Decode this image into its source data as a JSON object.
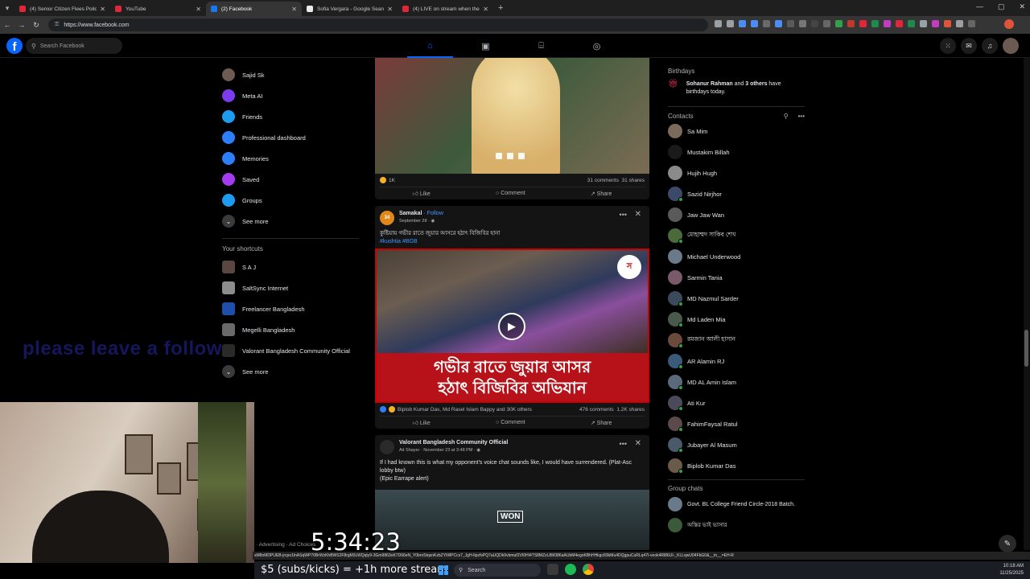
{
  "browser": {
    "tabs": [
      {
        "title": "(4) Senior Citizen Flees Police o",
        "color": "#e0263a"
      },
      {
        "title": "YouTube",
        "color": "#e0263a"
      },
      {
        "title": "(2) Facebook",
        "color": "#1877f2"
      },
      {
        "title": "Sofia Vergara - Google Search",
        "color": "#e8eaed"
      },
      {
        "title": "(4) LIVE on stream when the Ki",
        "color": "#e0263a"
      }
    ],
    "active_tab": 2,
    "url": "https://www.facebook.com"
  },
  "fb": {
    "search_placeholder": "Search Facebook",
    "nav_icons": [
      "home-icon",
      "video-icon",
      "marketplace-icon",
      "groups-icon"
    ],
    "left_nav": [
      {
        "label": "Sajid Sk",
        "icon": "profile-avatar",
        "color": "#6d5a52"
      },
      {
        "label": "Meta AI",
        "icon": "meta-ai-icon",
        "color": "#7b3cf0"
      },
      {
        "label": "Friends",
        "icon": "friends-icon",
        "color": "#1d9bf0"
      },
      {
        "label": "Professional dashboard",
        "icon": "dashboard-icon",
        "color": "#2d7ff9"
      },
      {
        "label": "Memories",
        "icon": "memories-icon",
        "color": "#2d7ff9"
      },
      {
        "label": "Saved",
        "icon": "saved-icon",
        "color": "#a33cf0"
      },
      {
        "label": "Groups",
        "icon": "groups-icon",
        "color": "#1d9bf0"
      },
      {
        "label": "See more",
        "icon": "chevron-down-icon",
        "color": "#3a3b3c"
      }
    ],
    "shortcuts_title": "Your shortcuts",
    "shortcuts": [
      {
        "label": "S A J",
        "color": "#5a4840"
      },
      {
        "label": "SaltSync Internet",
        "color": "#8c8c8c"
      },
      {
        "label": "Freelancer Bangladesh",
        "color": "#1f4fa8"
      },
      {
        "label": "Megelli Bangladesh",
        "color": "#6a6a6a"
      },
      {
        "label": "Valorant Bangladesh Community Official",
        "color": "#2a2a2a"
      },
      {
        "label": "See more",
        "color": "#3a3b3c"
      }
    ],
    "posts": {
      "p1": {
        "reactions": "1K",
        "comments": "31 comments",
        "shares": "31 shares",
        "like": "Like",
        "comment": "Comment",
        "share": "Share"
      },
      "p2": {
        "author": "Samakal",
        "follow": "· Follow",
        "date": "September 28 · ",
        "text": "কুষ্টিয়ায় গভীর রাতে জুয়ার আসরে হঠাৎ বিজিবির হানা",
        "tags": "#kushtia #BGB",
        "banner_line1": "গভীর রাতে জুয়ার আসর",
        "banner_line2": "হঠাৎ বিজিবির অভিযান",
        "logo": "স",
        "reactors": "Biplob Kumar Das, Md Rasel Islam Bappy and 30K others",
        "comments": "476 comments",
        "shares": "1.2K shares",
        "like": "Like",
        "comment": "Comment",
        "share": "Share"
      },
      "p3": {
        "author": "Valorant Bangladesh Community Official",
        "sub": "Ait Shayer · November 23 at 3:48 PM · ",
        "text1": "If I had known this is what my opponent's voice chat sounds like, I would have surrendered. (Plat-Asc lobby btw)",
        "text2": "(Epic Earrape alert)",
        "overlay": "WON"
      }
    },
    "birthdays": {
      "title": "Birthdays",
      "name": "Sohanur Rahman",
      "rest": " and ",
      "others": "3 others",
      "tail": " have birthdays today."
    },
    "contacts_title": "Contacts",
    "contacts": [
      {
        "name": "Sa Mim",
        "color": "#7a6a5a",
        "online": false
      },
      {
        "name": "Mustakim Billah",
        "color": "#1a1a1a",
        "online": false
      },
      {
        "name": "Hujih Hugh",
        "color": "#8a8a8a",
        "online": false
      },
      {
        "name": "Sazid Nirjhor",
        "color": "#3c4a6a",
        "online": true
      },
      {
        "name": "Jaw Jaw Wan",
        "color": "#5a5a5a",
        "online": false
      },
      {
        "name": "মোহাম্মদ সাকিব শেখ",
        "color": "#4a6a3a",
        "online": true
      },
      {
        "name": "Michael Underwood",
        "color": "#6a7a8a",
        "online": false
      },
      {
        "name": "Sarmin Tania",
        "color": "#7a5a6a",
        "online": false
      },
      {
        "name": "MD Nazmul Sarder",
        "color": "#3a4a5a",
        "online": true
      },
      {
        "name": "Md Laden Mia",
        "color": "#4a5a4a",
        "online": true
      },
      {
        "name": "রমজান আলী হাসান",
        "color": "#6a4a3a",
        "online": true
      },
      {
        "name": "AR Alamin RJ",
        "color": "#3a5a7a",
        "online": true
      },
      {
        "name": "MD AL Amin Islam",
        "color": "#5a6a7a",
        "online": true
      },
      {
        "name": "Ati Kur",
        "color": "#4a4a5a",
        "online": true
      },
      {
        "name": "FahimFaysal Ratul",
        "color": "#5a4a4a",
        "online": true
      },
      {
        "name": "Jubayer Al Masum",
        "color": "#4a5a6a",
        "online": true
      },
      {
        "name": "Biplob Kumar Das",
        "color": "#6a5a4a",
        "online": true
      }
    ],
    "group_chats_title": "Group chats",
    "group_chats": [
      {
        "name": "Govt. BL College Friend Circle-2018 Batch.",
        "color": "#6a7a8a"
      },
      {
        "name": "অস্তির ভাই ভাসার",
        "color": "#3a5a3a"
      }
    ]
  },
  "stream": {
    "follow_text": "please leave a follow",
    "timer": "5:34:23",
    "sub_message": "$5 (subs/kicks) = +1h more stream",
    "footer_links": "· Advertising · Ad Choices",
    "status_url": "sM8nMDPUEB-jrcpo1lnASqWP76BrWzKhBWS2F8rgM3LWQqty9-3Gm9863oK7D66eN_Y0bnrStqxnKzbZYtWPCcs7_JgH-ltpzfsPQ7aUQDk9vbmuf2VI0HI4TS8MZzL8M386aAUbM4egoKBhHHkgc83bMu4DQgpuCuRLq47I-veok4Rl86UI-_KLLqwU04FbG0&__tn__=EH-R"
  },
  "taskbar": {
    "search": "Search",
    "time": "10:18 AM",
    "date": "11/25/2025"
  }
}
